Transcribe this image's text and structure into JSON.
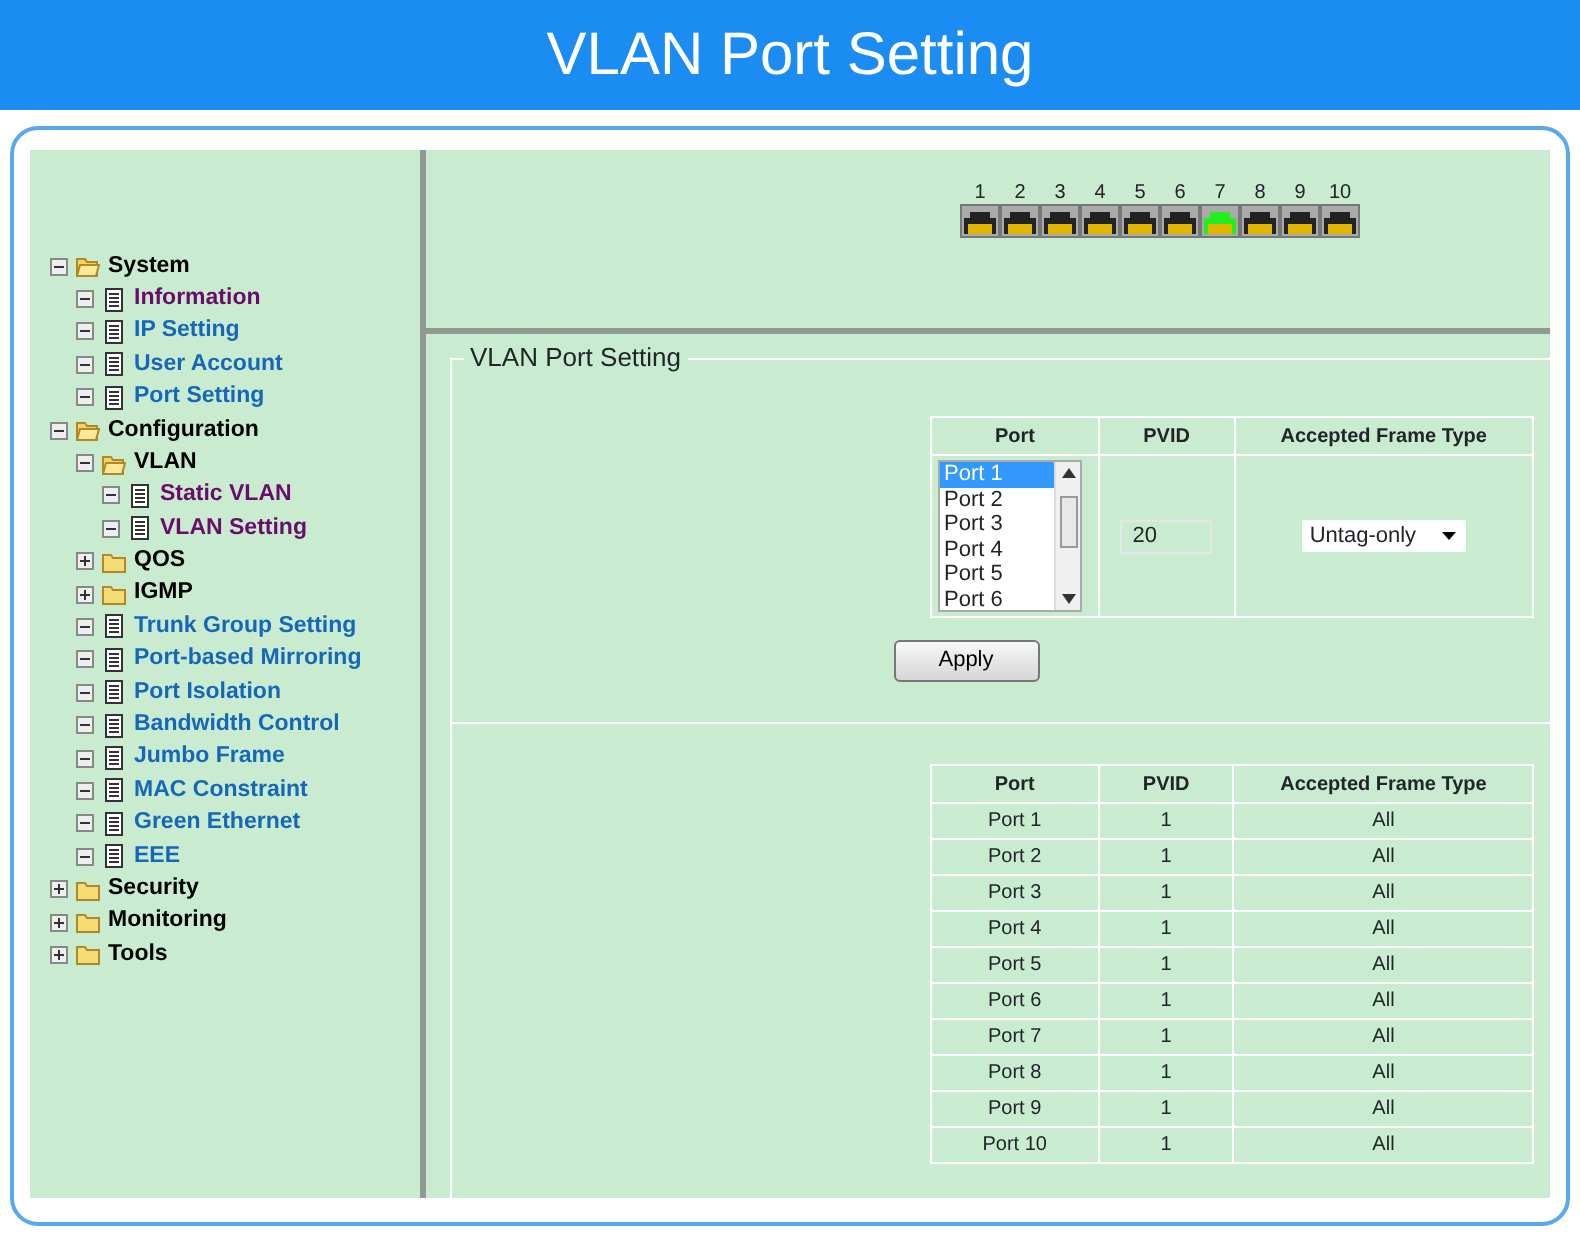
{
  "header": {
    "title": "VLAN Port Setting"
  },
  "tree": [
    {
      "label": "System",
      "kind": "folder",
      "expanded": true,
      "children": [
        {
          "label": "Information",
          "kind": "page",
          "visited": true
        },
        {
          "label": "IP Setting",
          "kind": "page",
          "visited": false
        },
        {
          "label": "User Account",
          "kind": "page",
          "visited": false
        },
        {
          "label": "Port Setting",
          "kind": "page",
          "visited": false
        }
      ]
    },
    {
      "label": "Configuration",
      "kind": "folder",
      "expanded": true,
      "children": [
        {
          "label": "VLAN",
          "kind": "folder",
          "expanded": true,
          "children": [
            {
              "label": "Static VLAN",
              "kind": "page",
              "visited": true
            },
            {
              "label": "VLAN Setting",
              "kind": "page",
              "visited": true
            }
          ]
        },
        {
          "label": "QOS",
          "kind": "folder",
          "expanded": false
        },
        {
          "label": "IGMP",
          "kind": "folder",
          "expanded": false
        },
        {
          "label": "Trunk Group Setting",
          "kind": "page",
          "visited": false
        },
        {
          "label": "Port-based Mirroring",
          "kind": "page",
          "visited": false
        },
        {
          "label": "Port Isolation",
          "kind": "page",
          "visited": false
        },
        {
          "label": "Bandwidth Control",
          "kind": "page",
          "visited": false
        },
        {
          "label": "Jumbo Frame",
          "kind": "page",
          "visited": false
        },
        {
          "label": "MAC Constraint",
          "kind": "page",
          "visited": false
        },
        {
          "label": "Green Ethernet",
          "kind": "page",
          "visited": false
        },
        {
          "label": "EEE",
          "kind": "page",
          "visited": false
        }
      ]
    },
    {
      "label": "Security",
      "kind": "folder",
      "expanded": false
    },
    {
      "label": "Monitoring",
      "kind": "folder",
      "expanded": false
    },
    {
      "label": "Tools",
      "kind": "folder",
      "expanded": false
    }
  ],
  "ports": [
    {
      "label": "1",
      "link": false
    },
    {
      "label": "2",
      "link": false
    },
    {
      "label": "3",
      "link": false
    },
    {
      "label": "4",
      "link": false
    },
    {
      "label": "5",
      "link": false
    },
    {
      "label": "6",
      "link": false
    },
    {
      "label": "7",
      "link": true
    },
    {
      "label": "8",
      "link": false
    },
    {
      "label": "9",
      "link": false
    },
    {
      "label": "10",
      "link": false
    }
  ],
  "form": {
    "legend": "VLAN Port Setting",
    "columns": [
      "Port",
      "PVID",
      "Accepted Frame Type"
    ],
    "port_list": [
      {
        "label": "Port 1",
        "selected": true
      },
      {
        "label": "Port 2",
        "selected": false
      },
      {
        "label": "Port 3",
        "selected": false
      },
      {
        "label": "Port 4",
        "selected": false
      },
      {
        "label": "Port 5",
        "selected": false
      },
      {
        "label": "Port 6",
        "selected": false
      }
    ],
    "pvid": "20",
    "frame_type": "Untag-only",
    "apply": "Apply"
  },
  "table": {
    "columns": [
      "Port",
      "PVID",
      "Accepted Frame Type"
    ],
    "rows": [
      [
        "Port 1",
        "1",
        "All"
      ],
      [
        "Port 2",
        "1",
        "All"
      ],
      [
        "Port 3",
        "1",
        "All"
      ],
      [
        "Port 4",
        "1",
        "All"
      ],
      [
        "Port 5",
        "1",
        "All"
      ],
      [
        "Port 6",
        "1",
        "All"
      ],
      [
        "Port 7",
        "1",
        "All"
      ],
      [
        "Port 8",
        "1",
        "All"
      ],
      [
        "Port 9",
        "1",
        "All"
      ],
      [
        "Port 10",
        "1",
        "All"
      ]
    ]
  }
}
